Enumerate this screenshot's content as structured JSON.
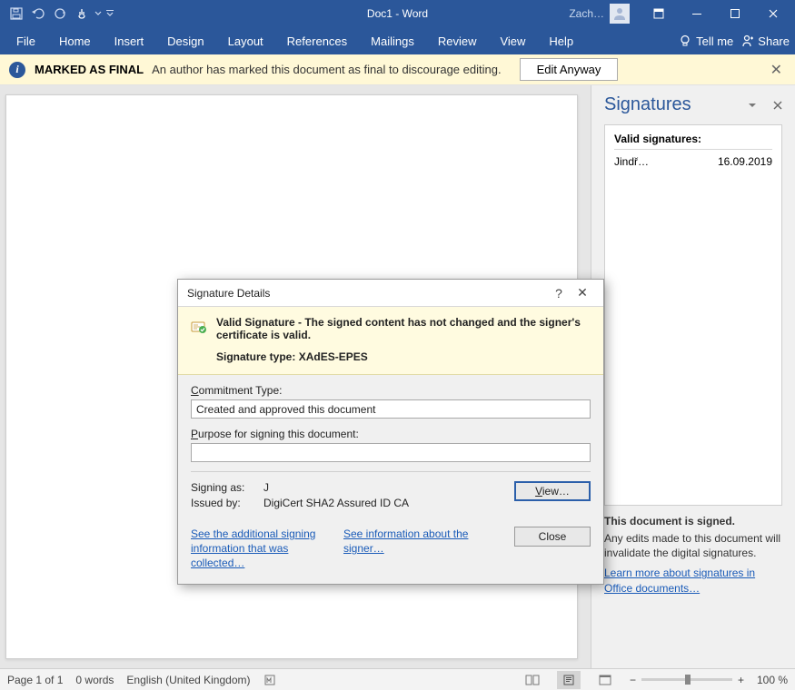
{
  "titlebar": {
    "doc_title": "Doc1 - Word",
    "user_name": "Zach…"
  },
  "ribbon": {
    "tabs": [
      "File",
      "Home",
      "Insert",
      "Design",
      "Layout",
      "References",
      "Mailings",
      "Review",
      "View",
      "Help"
    ],
    "tell_me": "Tell me",
    "share": "Share"
  },
  "msgbar": {
    "title": "MARKED AS FINAL",
    "message": "An author has marked this document as final to discourage editing.",
    "button": "Edit Anyway"
  },
  "pane": {
    "title": "Signatures",
    "section": "Valid signatures:",
    "row": {
      "name": "Jindř…",
      "date": "16.09.2019"
    },
    "footer_title": "This document is signed.",
    "footer_desc": "Any edits made to this document will invalidate the digital signatures.",
    "footer_link": "Learn more about signatures in Office documents…"
  },
  "dialog": {
    "title": "Signature Details",
    "banner_bold": "Valid Signature - The signed content has not changed and the signer's certificate is valid.",
    "banner_type_label": "Signature type: ",
    "banner_type_value": "XAdES-EPES",
    "commitment_label_pre": "C",
    "commitment_label_rest": "ommitment Type:",
    "commitment_value": "Created and approved this document",
    "purpose_label_pre": "P",
    "purpose_label_rest": "urpose for signing this document:",
    "purpose_value": "",
    "signing_as_label": "Signing as:",
    "signing_as_value": "J",
    "issued_by_label": "Issued by:",
    "issued_by_value": "DigiCert SHA2 Assured ID CA",
    "view_btn_pre": "V",
    "view_btn_rest": "iew…",
    "link1": "See the additional signing information that was collected…",
    "link2": "See information about the signer…",
    "close_btn": "Close"
  },
  "statusbar": {
    "page": "Page 1 of 1",
    "words": "0 words",
    "lang": "English (United Kingdom)",
    "zoom": "100 %"
  }
}
